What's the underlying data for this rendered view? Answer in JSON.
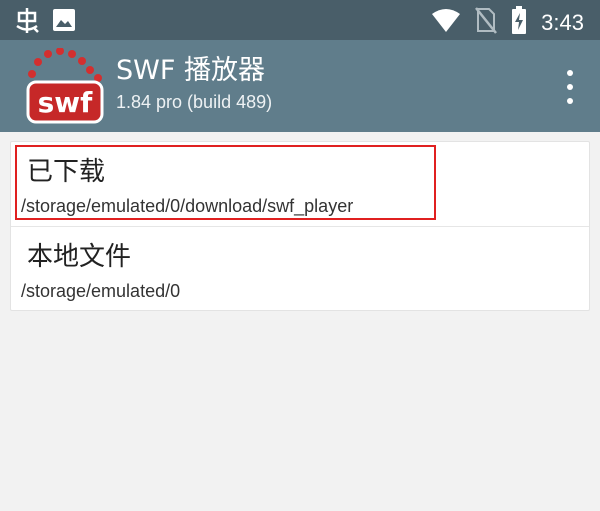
{
  "status_bar": {
    "time": "3:43",
    "left_icons": [
      "bug-icon",
      "image-icon"
    ],
    "right_icons": [
      "wifi-icon",
      "no-sim-icon",
      "battery-charging-icon"
    ]
  },
  "app_bar": {
    "logo_text": "swf",
    "title": "SWF 播放器",
    "subtitle": "1.84 pro (build 489)",
    "menu_icon": "overflow-menu-icon"
  },
  "list": {
    "items": [
      {
        "title": "已下载",
        "path": "/storage/emulated/0/download/swf_player"
      },
      {
        "title": "本地文件",
        "path": "/storage/emulated/0"
      }
    ]
  },
  "colors": {
    "status_bar": "#495e69",
    "app_bar": "#607d8b",
    "background": "#f2f2f2",
    "highlight": "#e02020",
    "logo_red": "#c62828"
  }
}
